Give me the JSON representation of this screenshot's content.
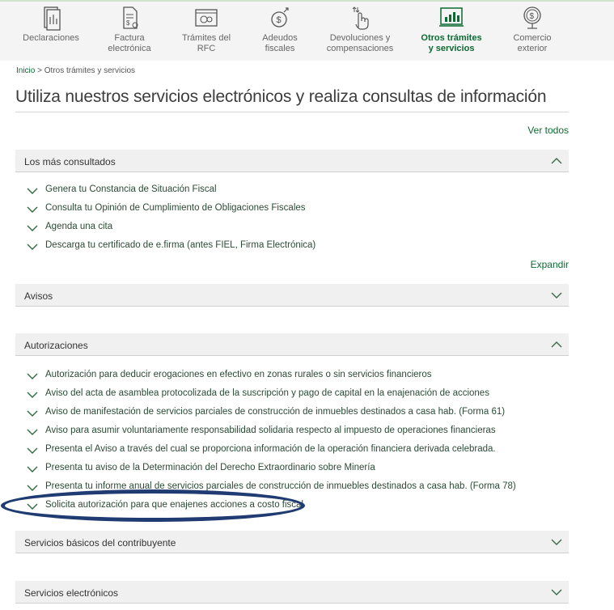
{
  "nav": {
    "items": [
      {
        "label": "Declaraciones",
        "icon": "declaraciones-icon",
        "active": false
      },
      {
        "label": "Factura\nelectrónica",
        "icon": "factura-icon",
        "active": false
      },
      {
        "label": "Trámites del\nRFC",
        "icon": "tramites-rfc-icon",
        "active": false
      },
      {
        "label": "Adeudos\nfiscales",
        "icon": "adeudos-icon",
        "active": false
      },
      {
        "label": "Devoluciones y\ncompensaciones",
        "icon": "devoluciones-icon",
        "active": false
      },
      {
        "label": "Otros trámites\ny servicios",
        "icon": "otros-tramites-icon",
        "active": true
      },
      {
        "label": "Comercio\nexterior",
        "icon": "comercio-exterior-icon",
        "active": false
      }
    ]
  },
  "breadcrumb": {
    "home": "Inicio",
    "separator": " > ",
    "current": "Otros trámites y servicios"
  },
  "page_title": "Utiliza nuestros servicios electrónicos y realiza consultas de información",
  "ver_todos": "Ver todos",
  "expandir": "Expandir",
  "sections": [
    {
      "title": "Los más consultados",
      "expanded": true,
      "items": [
        "Genera tu Constancia de Situación Fiscal",
        "Consulta tu Opinión de Cumplimiento de Obligaciones Fiscales",
        "Agenda una cita",
        "Descarga tu certificado de e.firma (antes FIEL, Firma Electrónica)"
      ]
    },
    {
      "title": "Avisos",
      "expanded": false,
      "items": []
    },
    {
      "title": "Autorizaciones",
      "expanded": true,
      "items": [
        "Autorización para deducir erogaciones en efectivo en zonas rurales o sin servicios financieros",
        "Aviso del acta de asamblea protocolizada de la suscripción y pago de capital en la enajenación de acciones",
        "Aviso de manifestación de servicios parciales de construcción de inmuebles destinados a casa hab. (Forma 61)",
        "Aviso para asumir voluntariamente responsabilidad solidaria respecto al impuesto de operaciones financieras",
        "Presenta el Aviso a través del cual se proporciona información de la operación financiera derivada celebrada.",
        "Presenta tu aviso de la Determinación del Derecho Extraordinario sobre Minería",
        "Presenta tu informe anual de servicios parciales de construcción de inmuebles destinados a casa hab. (Forma 78)",
        "Solicita autorización para que enajenes acciones a costo fiscal"
      ]
    },
    {
      "title": "Servicios básicos del contribuyente",
      "expanded": false,
      "items": []
    },
    {
      "title": "Servicios electrónicos",
      "expanded": false,
      "items": []
    }
  ],
  "colors": {
    "accent": "#0d6a33",
    "header_bg": "#f0f0f0",
    "highlight": "#1f3b72"
  }
}
